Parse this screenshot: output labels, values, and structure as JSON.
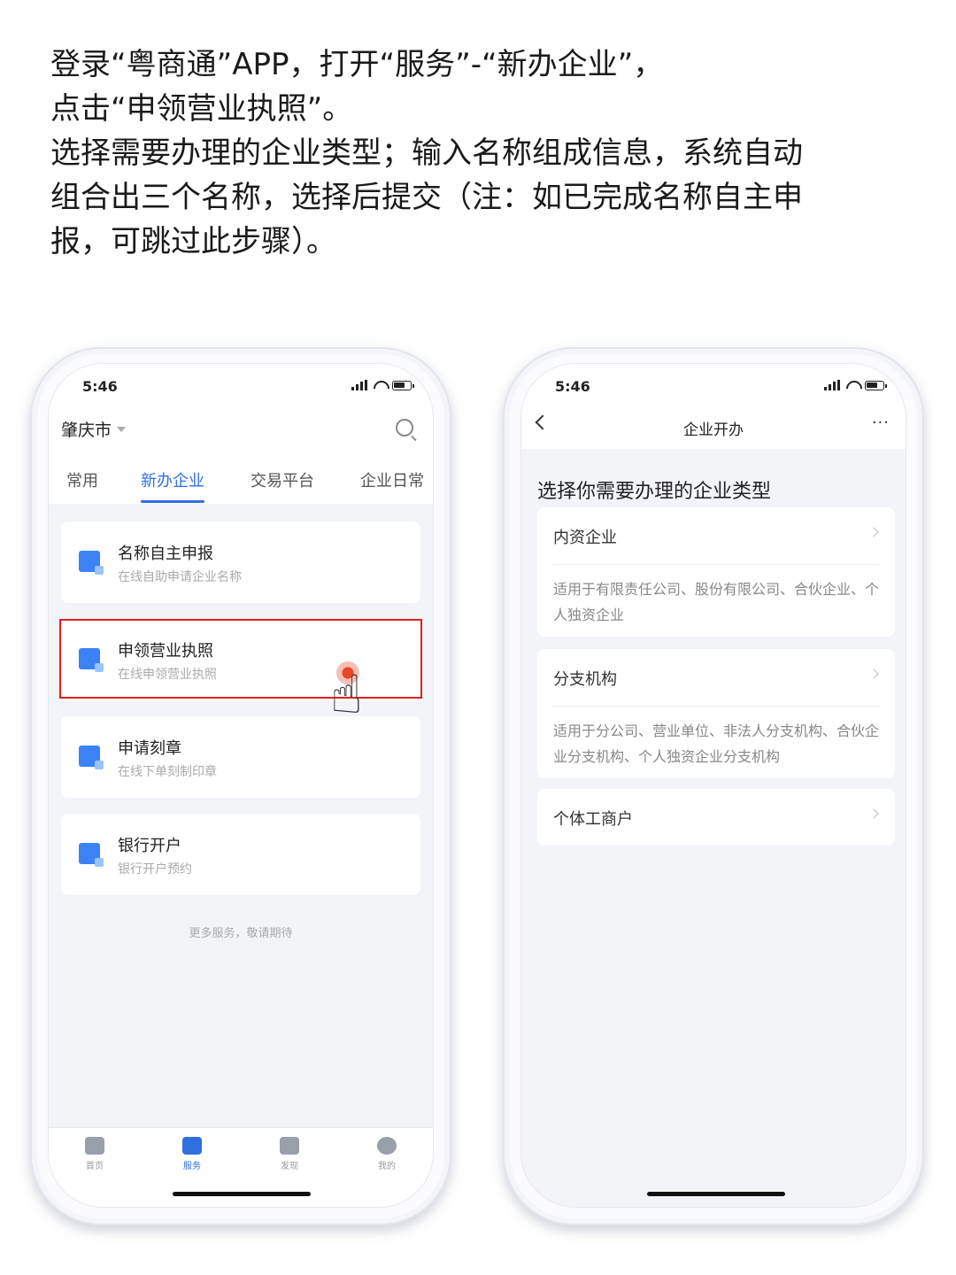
{
  "instructions": {
    "line1": "登录“粤商通”APP，打开“服务”-“新办企业”，",
    "line2": "点击“申领营业执照”。",
    "line3": "选择需要办理的企业类型；输入名称组成信息，系统自动",
    "line4": "组合出三个名称，选择后提交（注：如已完成名称自主申",
    "line5": "报，可跳过此步骤）。"
  },
  "left_phone": {
    "time": "5:46",
    "city": "肇庆市",
    "tabs": [
      "常用",
      "新办企业",
      "交易平台",
      "企业日常"
    ],
    "active_tab": "新办企业",
    "cards": [
      {
        "title": "名称自主申报",
        "subtitle": "在线自助申请企业名称"
      },
      {
        "title": "申领营业执照",
        "subtitle": "在线申领营业执照"
      },
      {
        "title": "申请刻章",
        "subtitle": "在线下单刻制印章"
      },
      {
        "title": "银行开户",
        "subtitle": "银行开户预约"
      }
    ],
    "more_text": "更多服务，敬请期待",
    "tabbar": [
      "首页",
      "服务",
      "发现",
      "我的"
    ],
    "active_tabbar": "服务",
    "accent_color": "#2f6fe0",
    "highlight_color": "#e02020"
  },
  "right_phone": {
    "time": "5:46",
    "nav_title": "企业开办",
    "more": "···",
    "heading": "选择你需要办理的企业类型",
    "options": [
      {
        "title": "内资企业",
        "desc": "适用于有限责任公司、股份有限公司、合伙企业、个人独资企业"
      },
      {
        "title": "分支机构",
        "desc": "适用于分公司、营业单位、非法人分支机构、合伙企业分支机构、个人独资企业分支机构"
      },
      {
        "title": "个体工商户",
        "desc": ""
      }
    ]
  }
}
